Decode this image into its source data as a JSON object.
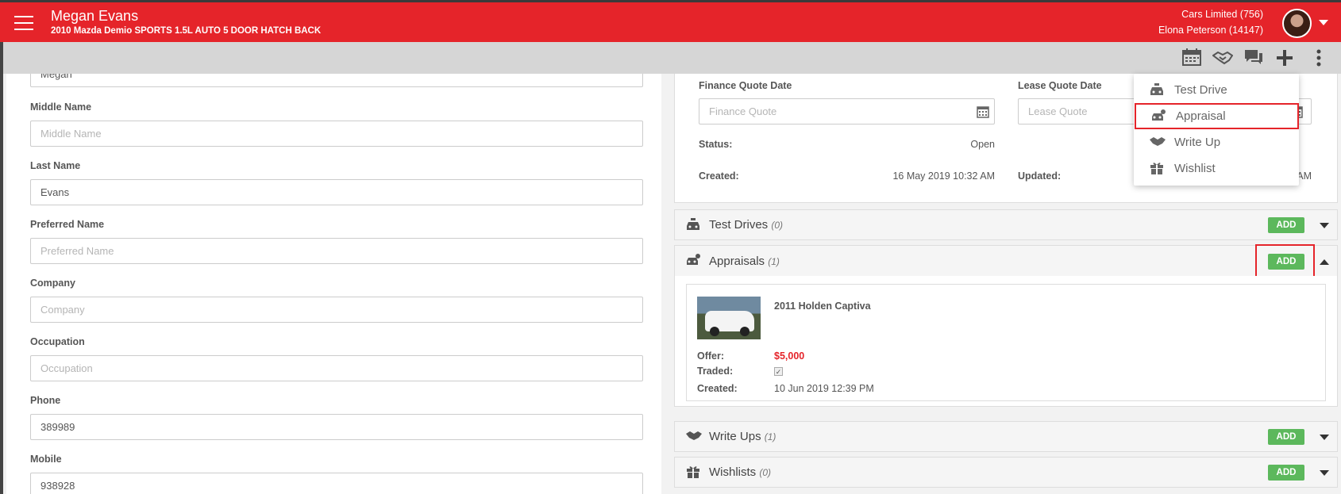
{
  "header": {
    "customer_name": "Megan Evans",
    "vehicle": "2010 Mazda Demio SPORTS 1.5L AUTO 5 DOOR HATCH BACK",
    "dealer": "Cars Limited (756)",
    "user": "Elona Peterson (14147)"
  },
  "toolbar": {
    "icons": [
      "calendar-icon",
      "handshake-icon",
      "chat-icon",
      "plus-icon",
      "more-vertical-icon"
    ]
  },
  "form": {
    "first_name_value": "Megan",
    "middle_name_label": "Middle Name",
    "middle_name_placeholder": "Middle Name",
    "last_name_label": "Last Name",
    "last_name_value": "Evans",
    "preferred_name_label": "Preferred Name",
    "preferred_name_placeholder": "Preferred Name",
    "company_label": "Company",
    "company_placeholder": "Company",
    "occupation_label": "Occupation",
    "occupation_placeholder": "Occupation",
    "phone_label": "Phone",
    "phone_value": "389989",
    "mobile_label": "Mobile",
    "mobile_value": "938928"
  },
  "quote": {
    "finance_label": "Finance Quote Date",
    "finance_placeholder": "Finance Quote",
    "lease_label": "Lease Quote Date",
    "lease_placeholder": "Lease Quote",
    "status_label": "Status:",
    "status_value": "Open",
    "created_label": "Created:",
    "created_value": "16 May 2019 10:32 AM",
    "updated_label": "Updated:",
    "updated_value_tail": "AM"
  },
  "sections": {
    "test_drives": {
      "title": "Test Drives",
      "count": "(0)",
      "add": "ADD"
    },
    "appraisals": {
      "title": "Appraisals",
      "count": "(1)",
      "add": "ADD"
    },
    "write_ups": {
      "title": "Write Ups",
      "count": "(1)",
      "add": "ADD"
    },
    "wishlists": {
      "title": "Wishlists",
      "count": "(0)",
      "add": "ADD"
    }
  },
  "appraisal": {
    "title": "2011 Holden Captiva",
    "offer_label": "Offer:",
    "offer_value": "$5,000",
    "traded_label": "Traded:",
    "traded_checked": true,
    "created_label": "Created:",
    "created_value": "10 Jun 2019 12:39 PM"
  },
  "dropdown": {
    "items": [
      {
        "label": "Test Drive",
        "icon": "car-icon"
      },
      {
        "label": "Appraisal",
        "icon": "appraisal-car-icon"
      },
      {
        "label": "Write Up",
        "icon": "handshake-icon"
      },
      {
        "label": "Wishlist",
        "icon": "gift-icon"
      }
    ]
  },
  "colors": {
    "brand_red": "#e5242a",
    "add_green": "#5cb85c",
    "toolbar_grey": "#d6d6d6"
  }
}
